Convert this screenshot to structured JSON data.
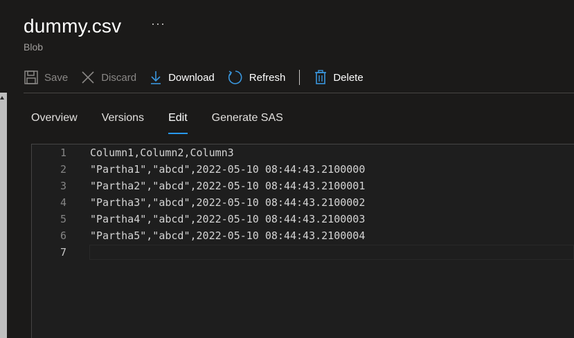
{
  "blade": {
    "title": "dummy.csv",
    "more_glyph": "···",
    "subtitle": "Blob"
  },
  "toolbar": {
    "buttons": [
      {
        "label": "Save",
        "icon": "save-icon",
        "enabled": false
      },
      {
        "label": "Discard",
        "icon": "close-icon",
        "enabled": false
      },
      {
        "label": "Download",
        "icon": "download-icon",
        "enabled": true
      },
      {
        "label": "Refresh",
        "icon": "refresh-icon",
        "enabled": true
      },
      {
        "label": "Delete",
        "icon": "trash-icon",
        "enabled": true
      }
    ]
  },
  "tabs": [
    {
      "label": "Overview",
      "active": false
    },
    {
      "label": "Versions",
      "active": false
    },
    {
      "label": "Edit",
      "active": true
    },
    {
      "label": "Generate SAS",
      "active": false
    }
  ],
  "editor": {
    "lines": [
      {
        "number": "1",
        "text": "Column1,Column2,Column3"
      },
      {
        "number": "2",
        "text": "\"Partha1\",\"abcd\",2022-05-10 08:44:43.2100000"
      },
      {
        "number": "3",
        "text": "\"Partha2\",\"abcd\",2022-05-10 08:44:43.2100001"
      },
      {
        "number": "4",
        "text": "\"Partha3\",\"abcd\",2022-05-10 08:44:43.2100002"
      },
      {
        "number": "5",
        "text": "\"Partha4\",\"abcd\",2022-05-10 08:44:43.2100003"
      },
      {
        "number": "6",
        "text": "\"Partha5\",\"abcd\",2022-05-10 08:44:43.2100004"
      },
      {
        "number": "7",
        "text": ""
      }
    ],
    "current_line": "7"
  },
  "colors": {
    "accent": "#2899f5",
    "background": "#1b1a19",
    "editor_background": "#1e1e1e"
  }
}
